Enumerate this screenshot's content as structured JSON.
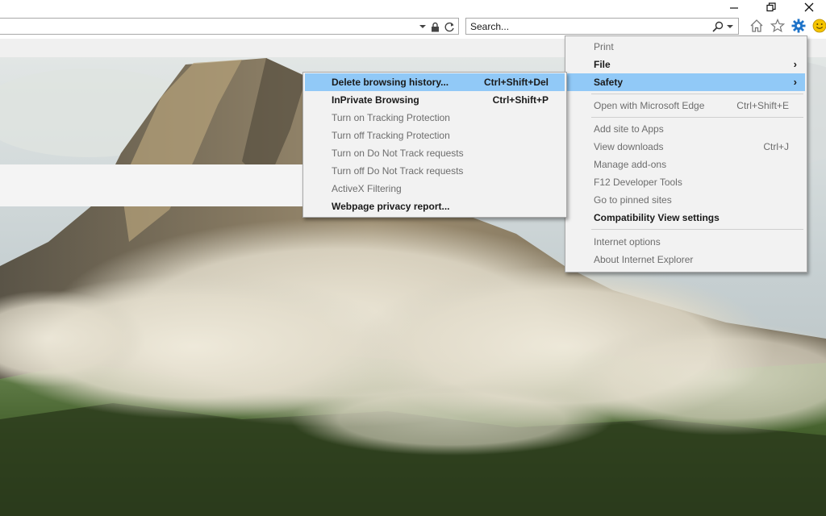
{
  "search": {
    "placeholder": "Search..."
  },
  "tools": {
    "home_icon": "home-icon",
    "favorites_icon": "star-icon",
    "settings_icon": "gear-icon",
    "feedback_icon": "smiley-icon"
  },
  "main_menu": {
    "print": "Print",
    "file": "File",
    "safety": "Safety",
    "open_edge": "Open with Microsoft Edge",
    "open_edge_shortcut": "Ctrl+Shift+E",
    "add_site": "Add site to Apps",
    "view_downloads": "View downloads",
    "view_downloads_shortcut": "Ctrl+J",
    "manage_addons": "Manage add-ons",
    "f12": "F12 Developer Tools",
    "pinned": "Go to pinned sites",
    "compat": "Compatibility View settings",
    "internet_options": "Internet options",
    "about": "About Internet Explorer"
  },
  "safety_menu": {
    "delete_history": "Delete browsing history...",
    "delete_history_shortcut": "Ctrl+Shift+Del",
    "inprivate": "InPrivate Browsing",
    "inprivate_shortcut": "Ctrl+Shift+P",
    "tracking_on": "Turn on Tracking Protection",
    "tracking_off": "Turn off Tracking Protection",
    "dnt_on": "Turn on Do Not Track requests",
    "dnt_off": "Turn off Do Not Track requests",
    "activex": "ActiveX Filtering",
    "privacy_report": "Webpage privacy report..."
  },
  "colors": {
    "highlight": "#91c9f7",
    "menu_bg": "#f2f2f2",
    "gear": "#1e73c8",
    "smiley": "#f5c400"
  }
}
